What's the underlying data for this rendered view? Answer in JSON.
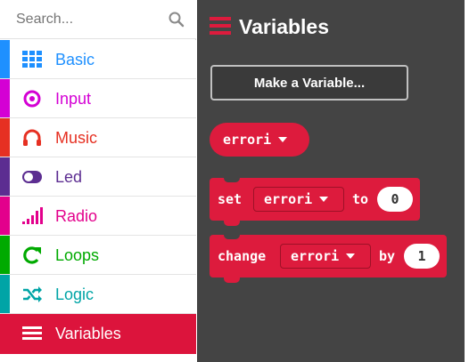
{
  "search": {
    "placeholder": "Search..."
  },
  "categories": [
    {
      "label": "Basic",
      "color": "#1e90ff",
      "icon": "grid-icon"
    },
    {
      "label": "Input",
      "color": "#d400d4",
      "icon": "target-icon"
    },
    {
      "label": "Music",
      "color": "#e63022",
      "icon": "headphones-icon"
    },
    {
      "label": "Led",
      "color": "#5c2d91",
      "icon": "toggle-icon"
    },
    {
      "label": "Radio",
      "color": "#e3008c",
      "icon": "signal-bars-icon"
    },
    {
      "label": "Loops",
      "color": "#00aa00",
      "icon": "loop-arrow-icon"
    },
    {
      "label": "Logic",
      "color": "#00a4a6",
      "icon": "shuffle-icon"
    },
    {
      "label": "Variables",
      "color": "#dc143c",
      "icon": "list-icon",
      "selected": true
    }
  ],
  "flyout": {
    "title": "Variables",
    "make_variable": "Make a Variable...",
    "variable_name": "errori",
    "set_block": {
      "keyword": "set",
      "variable": "errori",
      "to": "to",
      "value": "0"
    },
    "change_block": {
      "keyword": "change",
      "variable": "errori",
      "by": "by",
      "value": "1"
    }
  },
  "colors": {
    "variables": "#dd1b3d",
    "flyout_bg": "#444444"
  }
}
